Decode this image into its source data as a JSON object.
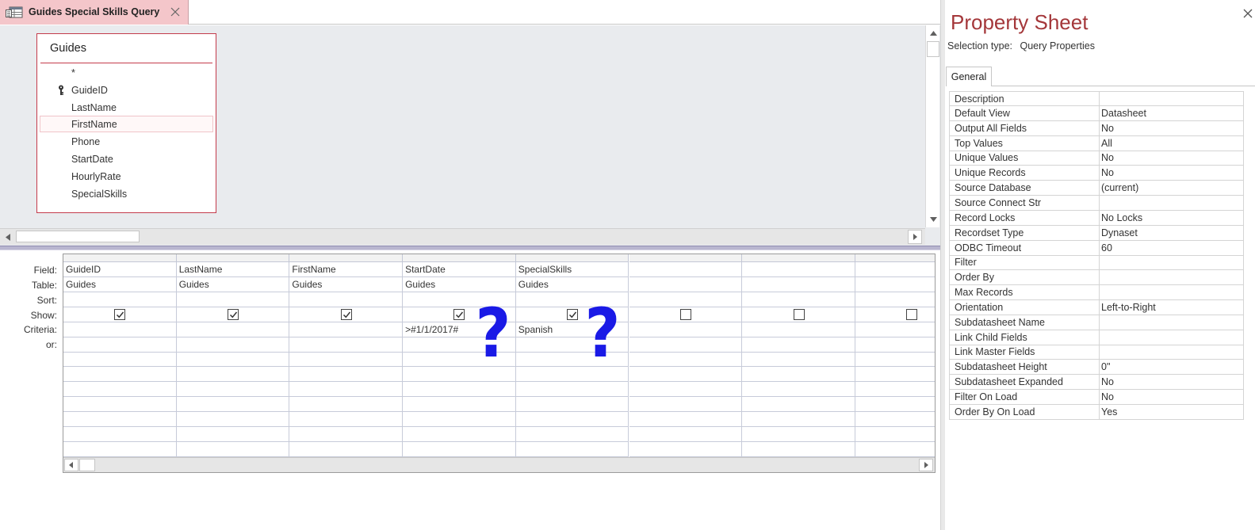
{
  "document_tab": {
    "title": "Guides Special Skills Query",
    "icon": "query-icon",
    "close_icon": "close-icon"
  },
  "table_box": {
    "title": "Guides",
    "fields": [
      {
        "label": "*",
        "key": false,
        "selected": false
      },
      {
        "label": "GuideID",
        "key": true,
        "selected": false
      },
      {
        "label": "LastName",
        "key": false,
        "selected": false
      },
      {
        "label": "FirstName",
        "key": false,
        "selected": true
      },
      {
        "label": "Phone",
        "key": false,
        "selected": false
      },
      {
        "label": "StartDate",
        "key": false,
        "selected": false
      },
      {
        "label": "HourlyRate",
        "key": false,
        "selected": false
      },
      {
        "label": "SpecialSkills",
        "key": false,
        "selected": false
      }
    ]
  },
  "qbe_grid": {
    "row_labels": [
      "Field:",
      "Table:",
      "Sort:",
      "Show:",
      "Criteria:",
      "or:"
    ],
    "columns": [
      {
        "field": "GuideID",
        "table": "Guides",
        "sort": "",
        "show": true,
        "criteria": "",
        "or": ""
      },
      {
        "field": "LastName",
        "table": "Guides",
        "sort": "",
        "show": true,
        "criteria": "",
        "or": ""
      },
      {
        "field": "FirstName",
        "table": "Guides",
        "sort": "",
        "show": true,
        "criteria": "",
        "or": ""
      },
      {
        "field": "StartDate",
        "table": "Guides",
        "sort": "",
        "show": true,
        "criteria": ">#1/1/2017#",
        "or": ""
      },
      {
        "field": "SpecialSkills",
        "table": "Guides",
        "sort": "",
        "show": true,
        "criteria": "Spanish",
        "or": ""
      },
      {
        "field": "",
        "table": "",
        "sort": "",
        "show": false,
        "criteria": "",
        "or": ""
      },
      {
        "field": "",
        "table": "",
        "sort": "",
        "show": false,
        "criteria": "",
        "or": ""
      },
      {
        "field": "",
        "table": "",
        "sort": "",
        "show": false,
        "criteria": "",
        "or": ""
      }
    ]
  },
  "annotations": {
    "mark1": "?",
    "mark2": "?",
    "color": "#1a1ae6"
  },
  "property_sheet": {
    "title": "Property Sheet",
    "selection_label": "Selection type:",
    "selection_value": "Query Properties",
    "tab": "General",
    "properties": [
      {
        "name": "Description",
        "value": ""
      },
      {
        "name": "Default View",
        "value": "Datasheet"
      },
      {
        "name": "Output All Fields",
        "value": "No"
      },
      {
        "name": "Top Values",
        "value": "All"
      },
      {
        "name": "Unique Values",
        "value": "No"
      },
      {
        "name": "Unique Records",
        "value": "No"
      },
      {
        "name": "Source Database",
        "value": "(current)"
      },
      {
        "name": "Source Connect Str",
        "value": ""
      },
      {
        "name": "Record Locks",
        "value": "No Locks"
      },
      {
        "name": "Recordset Type",
        "value": "Dynaset"
      },
      {
        "name": "ODBC Timeout",
        "value": "60"
      },
      {
        "name": "Filter",
        "value": ""
      },
      {
        "name": "Order By",
        "value": ""
      },
      {
        "name": "Max Records",
        "value": ""
      },
      {
        "name": "Orientation",
        "value": "Left-to-Right"
      },
      {
        "name": "Subdatasheet Name",
        "value": ""
      },
      {
        "name": "Link Child Fields",
        "value": ""
      },
      {
        "name": "Link Master Fields",
        "value": ""
      },
      {
        "name": "Subdatasheet Height",
        "value": "0\""
      },
      {
        "name": "Subdatasheet Expanded",
        "value": "No"
      },
      {
        "name": "Filter On Load",
        "value": "No"
      },
      {
        "name": "Order By On Load",
        "value": "Yes"
      }
    ]
  },
  "colors": {
    "accent": "#a4373a",
    "tab_bg": "#f4c6ca",
    "table_border": "#c43b4b",
    "pane_bg": "#e9ebee",
    "splitter": "#b9b6cf"
  }
}
